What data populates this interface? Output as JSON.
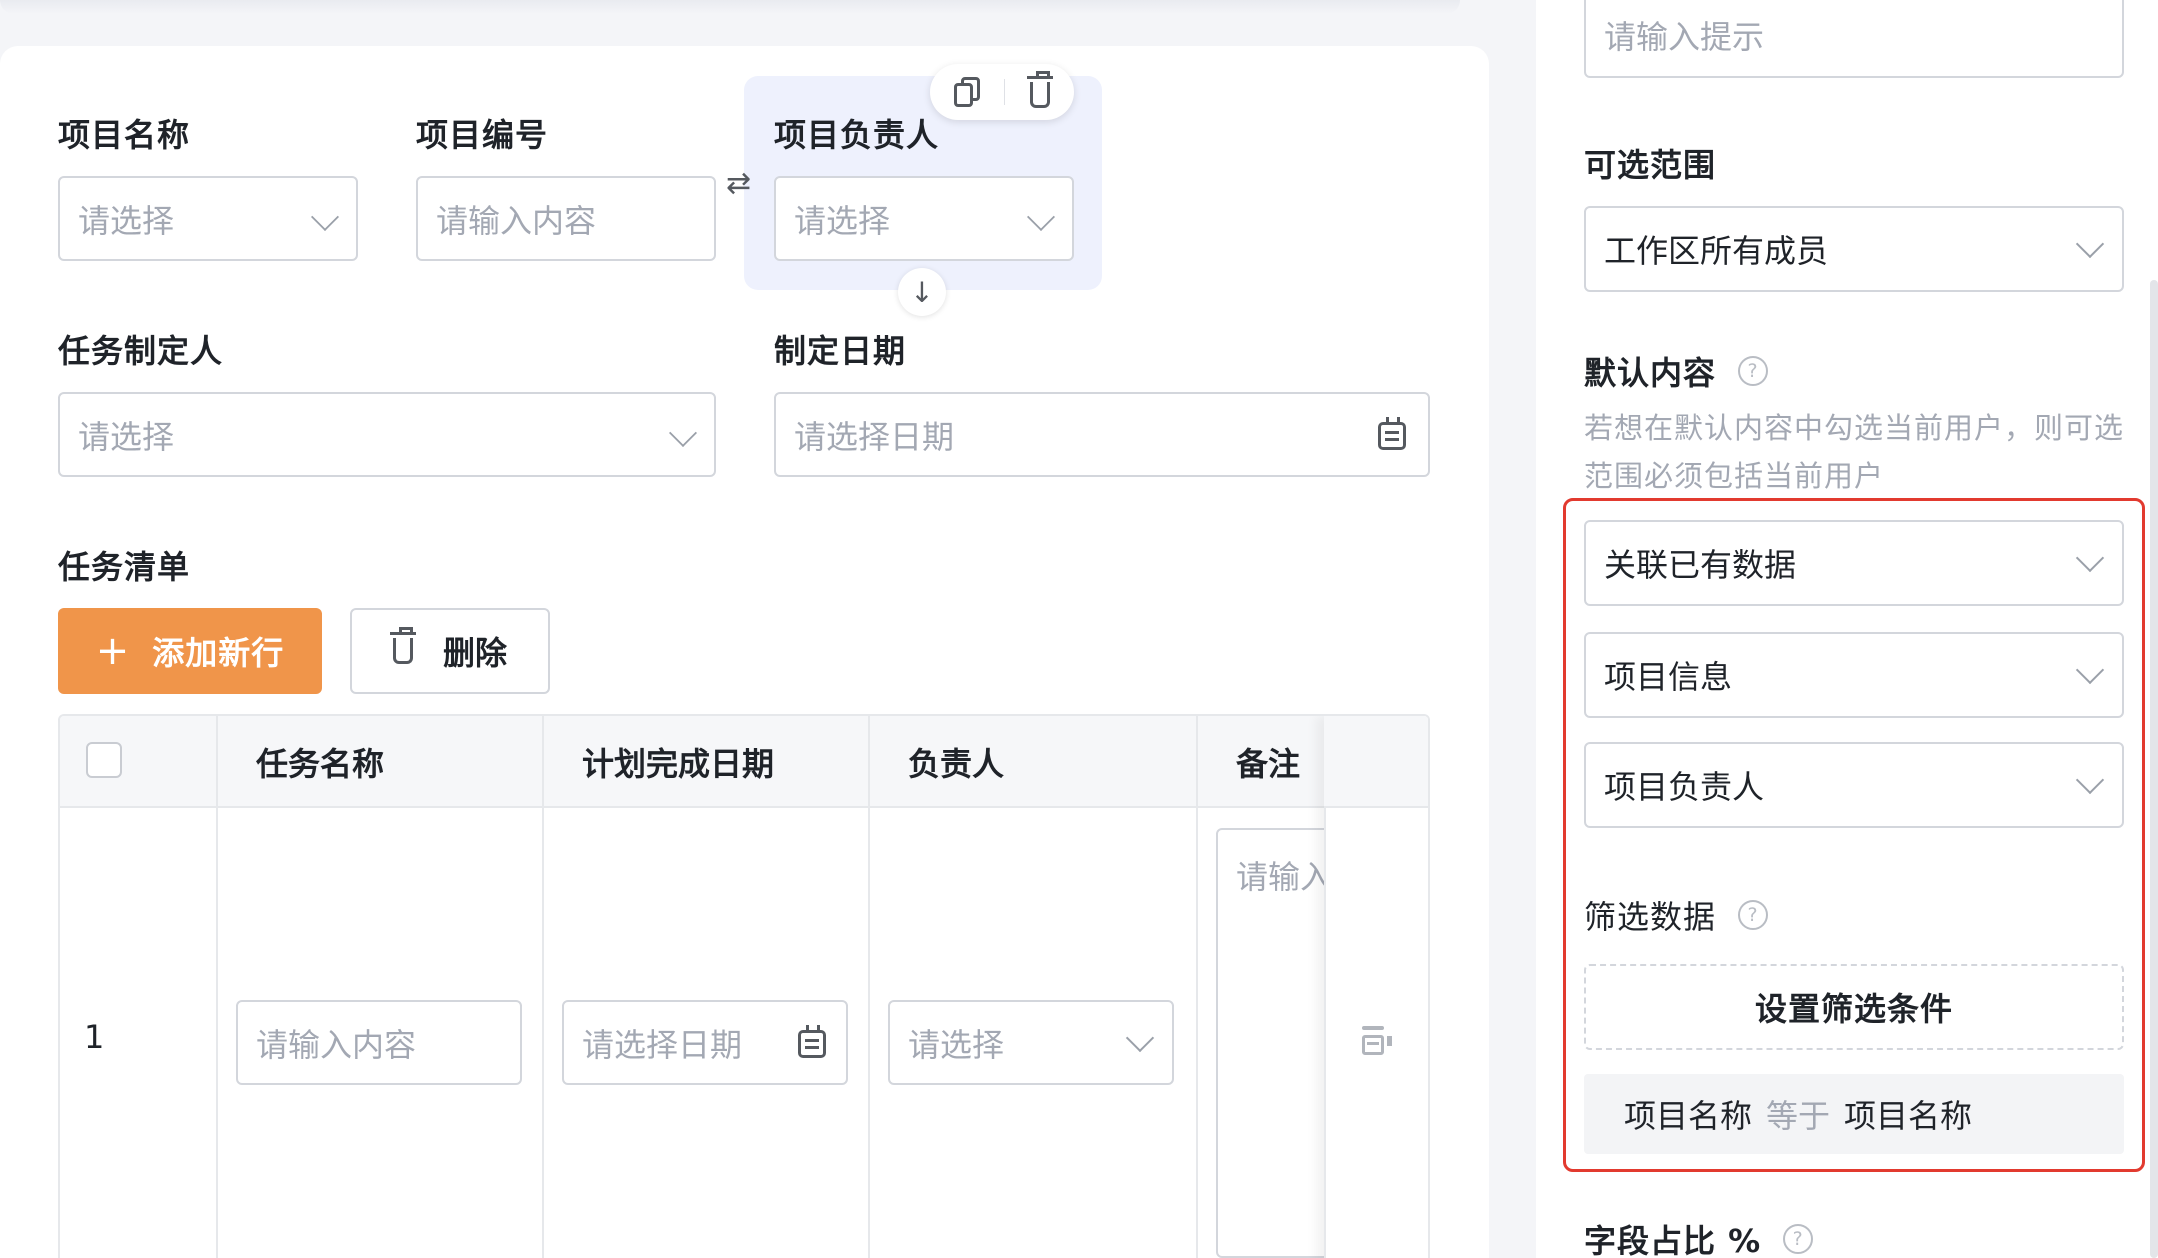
{
  "form": {
    "project_name_label": "项目名称",
    "project_name_placeholder": "请选择",
    "project_no_label": "项目编号",
    "project_no_placeholder": "请输入内容",
    "project_owner_label": "项目负责人",
    "project_owner_placeholder": "请选择",
    "task_creator_label": "任务制定人",
    "task_creator_placeholder": "请选择",
    "create_date_label": "制定日期",
    "create_date_placeholder": "请选择日期",
    "task_list_label": "任务清单",
    "add_row_button": "添加新行",
    "delete_button": "删除"
  },
  "table": {
    "columns": [
      "任务名称",
      "计划完成日期",
      "负责人",
      "备注"
    ],
    "rows": [
      {
        "index": "1",
        "task_name_placeholder": "请输入内容",
        "date_placeholder": "请选择日期",
        "owner_placeholder": "请选择",
        "remark_placeholder": "请输入"
      }
    ]
  },
  "panel": {
    "top_field_placeholder": "请输入提示",
    "range_label": "可选范围",
    "range_value": "工作区所有成员",
    "default_label": "默认内容",
    "default_hint": "若想在默认内容中勾选当前用户，则可选范围必须包括当前用户",
    "default_mode_value": "关联已有数据",
    "source_form_value": "项目信息",
    "source_field_value": "项目负责人",
    "filter_label": "筛选数据",
    "filter_button": "设置筛选条件",
    "condition": {
      "field": "项目名称",
      "operator": "等于",
      "value": "项目名称"
    },
    "width_label": "字段占比 %"
  },
  "colors": {
    "accent_orange": "#f0954a",
    "selected_bg": "#eef1fd",
    "highlight_red": "#e23a2f"
  }
}
